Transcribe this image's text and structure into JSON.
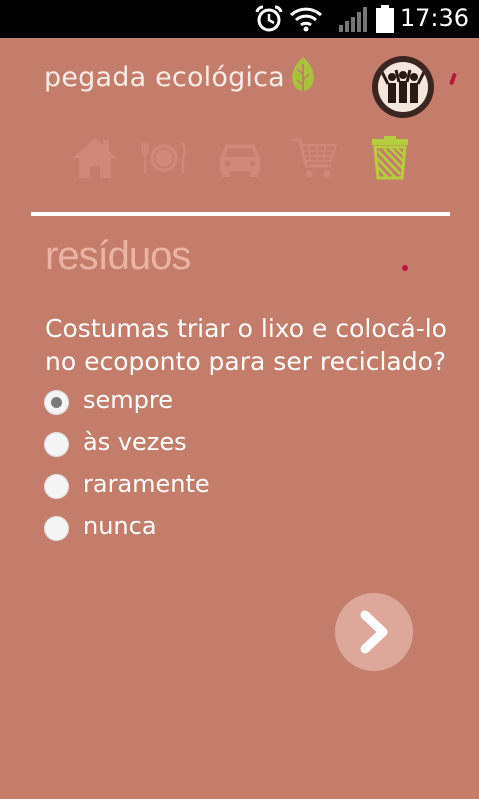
{
  "status_bar": {
    "time": "17:36",
    "icons": [
      "alarm-icon",
      "wifi-icon",
      "signal-icon",
      "battery-icon"
    ]
  },
  "header": {
    "app_name": "pegada ecológica",
    "logo_icon": "leaf-icon",
    "avatar_icon": "group-people-icon"
  },
  "categories": [
    {
      "icon": "house-icon",
      "active": false
    },
    {
      "icon": "plate-cutlery-icon",
      "active": false
    },
    {
      "icon": "car-icon",
      "active": false
    },
    {
      "icon": "shopping-cart-icon",
      "active": false
    },
    {
      "icon": "trash-bin-icon",
      "active": true
    }
  ],
  "section": {
    "title": "resíduos"
  },
  "question": {
    "text": "Costumas triar o lixo e colocá-lo no ecoponto para ser reciclado?",
    "options": [
      {
        "label": "sempre",
        "selected": true
      },
      {
        "label": "às vezes",
        "selected": false
      },
      {
        "label": "raramente",
        "selected": false
      },
      {
        "label": "nunca",
        "selected": false
      }
    ]
  },
  "next_button": {
    "icon": "chevron-right-icon"
  },
  "colors": {
    "background": "#c47d6b",
    "active_icon": "#b5cf3c",
    "inactive_icon": "#d0887a",
    "title": "#ebb3a4",
    "accent_red": "#b8163d"
  }
}
